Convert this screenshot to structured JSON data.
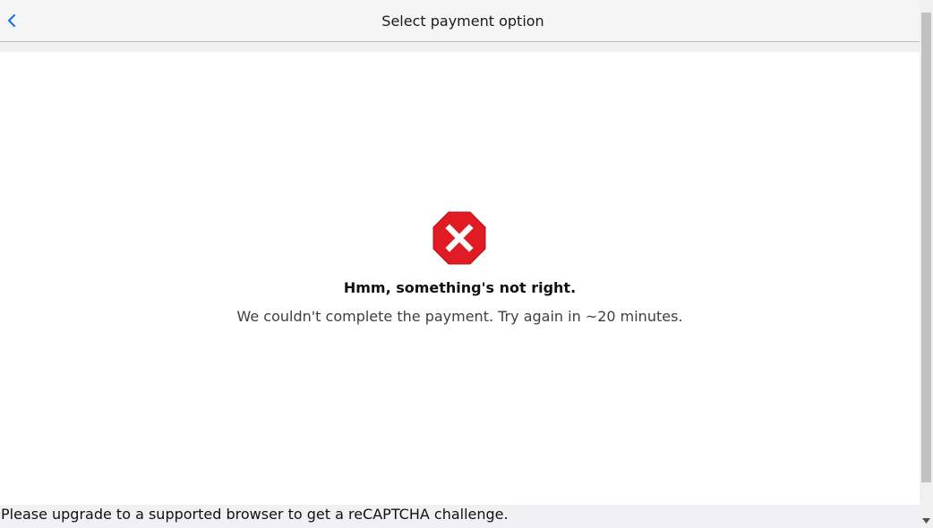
{
  "header": {
    "title": "Select payment option",
    "back_icon": "chevron-left-icon"
  },
  "error": {
    "icon": "error-octagon-x-icon",
    "heading": "Hmm, something's not right.",
    "message": "We couldn't complete the payment. Try again in ~20 minutes."
  },
  "recaptcha": {
    "notice": "Please upgrade to a supported browser to get a reCAPTCHA challenge."
  },
  "colors": {
    "accent": "#1a73e8",
    "error_red": "#e01b24",
    "header_bg": "#f5f5f6"
  }
}
